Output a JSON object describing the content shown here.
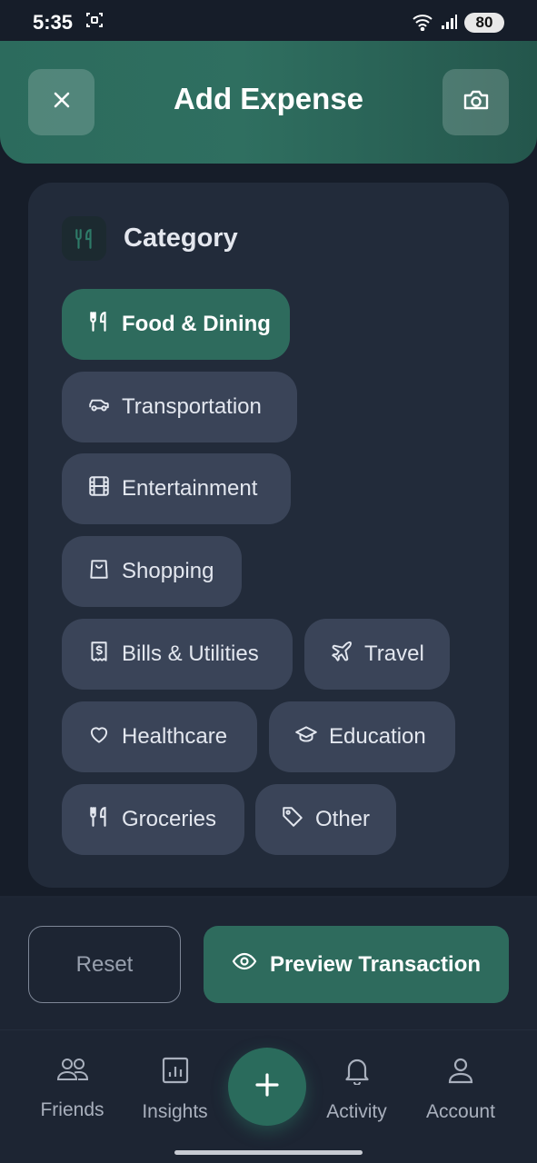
{
  "status": {
    "time": "5:35",
    "battery": "80",
    "wifi_label": "5"
  },
  "header": {
    "title": "Add Expense",
    "close_icon": "close-icon",
    "camera_icon": "camera-icon"
  },
  "category": {
    "title": "Category",
    "icon": "utensils-icon",
    "selected": "Food & Dining",
    "chips": [
      {
        "label": "Food & Dining",
        "icon": "utensils-icon",
        "active": true
      },
      {
        "label": "Transportation",
        "icon": "car-icon",
        "active": false
      },
      {
        "label": "Entertainment",
        "icon": "film-icon",
        "active": false
      },
      {
        "label": "Shopping",
        "icon": "shopping-bag-icon",
        "active": false
      },
      {
        "label": "Bills & Utilities",
        "icon": "receipt-icon",
        "active": false
      },
      {
        "label": "Travel",
        "icon": "plane-icon",
        "active": false
      },
      {
        "label": "Healthcare",
        "icon": "heart-icon",
        "active": false
      },
      {
        "label": "Education",
        "icon": "graduation-cap-icon",
        "active": false
      },
      {
        "label": "Groceries",
        "icon": "utensils-icon",
        "active": false
      },
      {
        "label": "Other",
        "icon": "tag-icon",
        "active": false
      }
    ]
  },
  "actions": {
    "reset_label": "Reset",
    "preview_label": "Preview Transaction"
  },
  "nav": {
    "items": [
      {
        "label": "Friends",
        "icon": "users-icon"
      },
      {
        "label": "Insights",
        "icon": "chart-icon"
      },
      {
        "label": "Activity",
        "icon": "bell-icon"
      },
      {
        "label": "Account",
        "icon": "user-icon"
      }
    ],
    "fab_icon": "plus-icon"
  },
  "colors": {
    "accent": "#2e6b5d",
    "background": "#161d29",
    "card": "#222b3a",
    "chip": "#3a4458"
  }
}
